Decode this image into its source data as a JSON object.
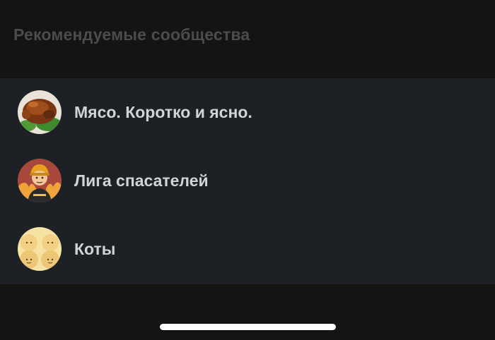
{
  "section": {
    "title": "Рекомендуемые сообщества"
  },
  "communities": [
    {
      "name": "Мясо. Коротко и ясно.",
      "avatar_icon": "roast-chicken-icon"
    },
    {
      "name": "Лига спасателей",
      "avatar_icon": "firefighter-icon"
    },
    {
      "name": "Коты",
      "avatar_icon": "cats-icon"
    }
  ],
  "colors": {
    "background": "#141414",
    "list_background": "#1d2024",
    "title_text": "#4c4c4e",
    "item_text": "#d2d3d6",
    "home_indicator": "#ffffff"
  }
}
